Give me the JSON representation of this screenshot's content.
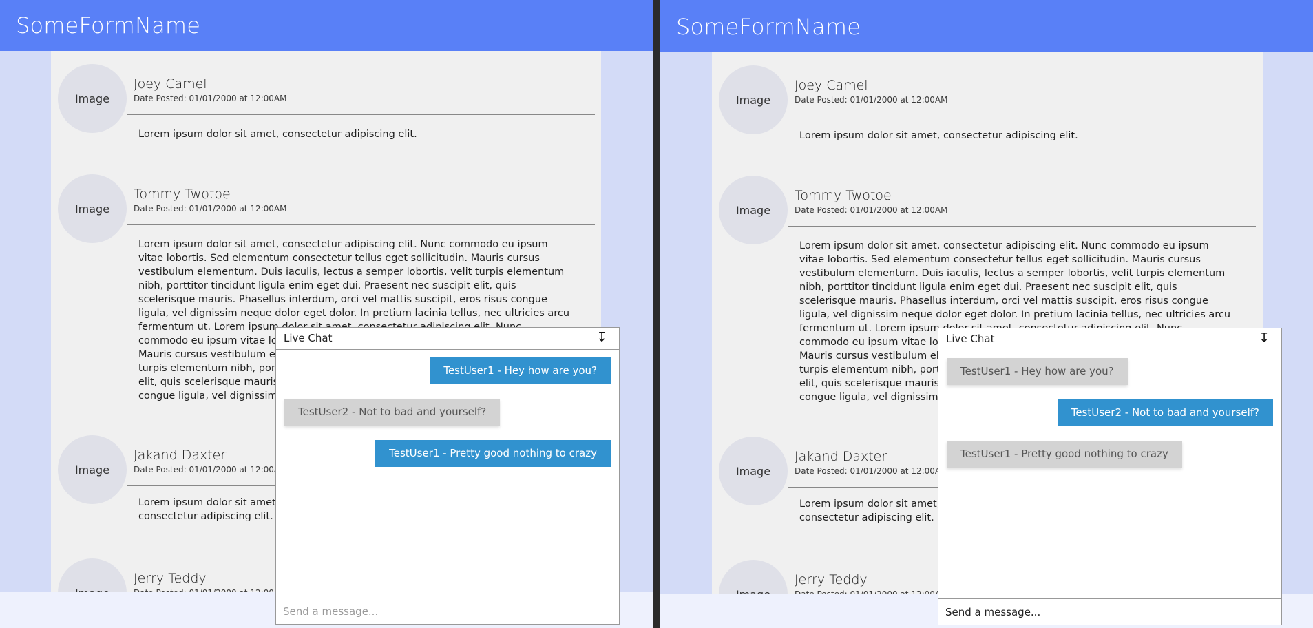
{
  "brand": "SomeFormName",
  "avatar_label": "Image",
  "posts": [
    {
      "author": "Joey Camel",
      "date": "Date Posted: 01/01/2000 at 12:00AM",
      "body": "Lorem ipsum dolor sit amet, consectetur adipiscing elit."
    },
    {
      "author": "Tommy Twotoe",
      "date": "Date Posted: 01/01/2000 at 12:00AM",
      "body": "Lorem ipsum dolor sit amet, consectetur adipiscing elit. Nunc commodo eu ipsum vitae lobortis. Sed elementum consectetur tellus eget sollicitudin. Mauris cursus vestibulum elementum. Duis iaculis, lectus a semper lobortis, velit turpis elementum nibh, porttitor tincidunt ligula enim eget dui. Praesent nec suscipit elit, quis scelerisque mauris. Phasellus interdum, orci vel mattis suscipit, eros risus congue ligula, vel dignissim neque dolor eget dolor. In pretium lacinia tellus, nec ultricies arcu fermentum ut. Lorem ipsum dolor sit amet, consectetur adipiscing elit. Nunc commodo eu ipsum vitae lobortis. Sed elementum consectetur tellus eget sollicitudin. Mauris cursus vestibulum elementum. Duis iaculis, lectus a semper lobortis, velit turpis elementum nibh, porttitor tincidunt ligula enim eget dui. Praesent nec suscipit elit, quis scelerisque mauris. Phasellus interdum, orci vel mattis suscipit, eros risus congue ligula, vel dignissim neque dolor eget dolor. In pretium lacinia tellus, nec ultricies arcu fermentum ut."
    },
    {
      "author": "Jakand Daxter",
      "date": "Date Posted: 01/01/2000 at 12:00AM",
      "body": "Lorem ipsum dolor sit amet, consectetur adipiscing elit. Lorem ipsum dolor sit amet, consectetur adipiscing elit."
    },
    {
      "author": "Jerry Teddy",
      "date": "Date Posted: 01/01/2000 at 12:00AM",
      "body": ""
    }
  ],
  "chat": {
    "title": "Live Chat",
    "toggle_glyph": "↧",
    "messages": [
      "TestUser1 - Hey how are you?",
      "TestUser2 - Not to bad and yourself?",
      "TestUser1 - Pretty good nothing to crazy"
    ],
    "placeholder": "Send a message..."
  },
  "colors": {
    "header": "#5980f7",
    "page_bg": "#d3dbf7",
    "content_bg": "#f0f0f0",
    "bubble_blue": "#3192cf",
    "bubble_grey": "#d3d3d3",
    "divider": "#2b2b2b"
  }
}
